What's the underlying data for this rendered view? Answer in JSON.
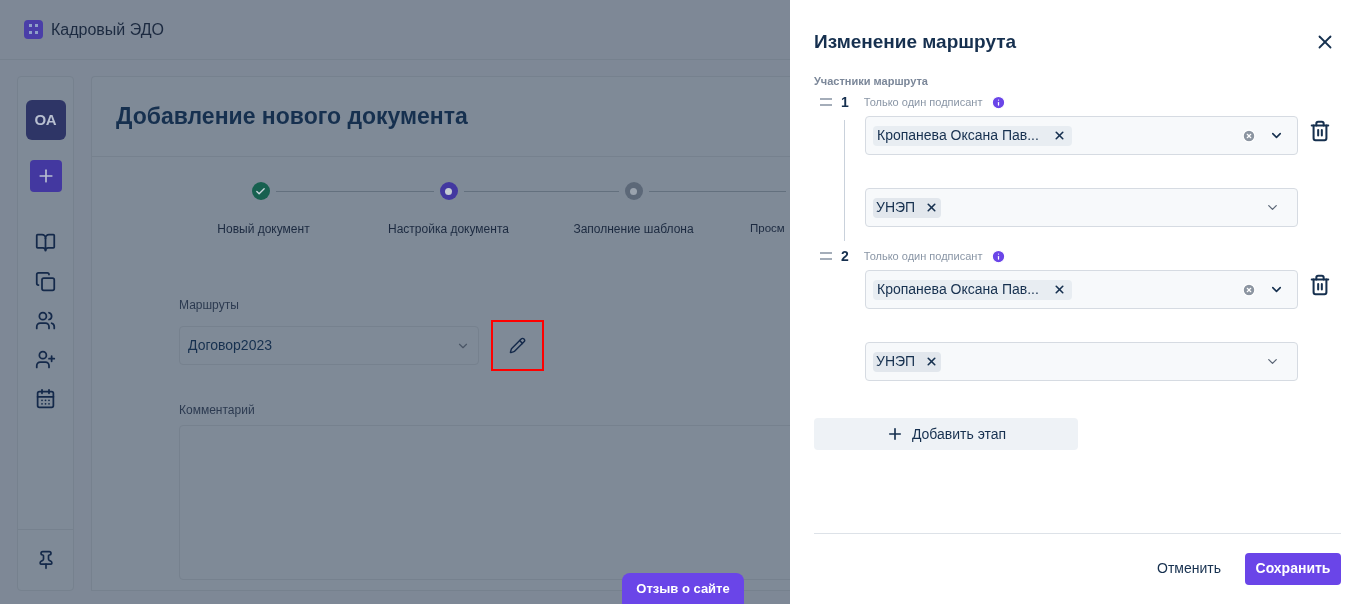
{
  "app": {
    "title": "Кадровый ЭДО"
  },
  "sidebar": {
    "avatar": "ОА"
  },
  "page": {
    "title": "Добавление нового документа",
    "steps": [
      {
        "label": "Новый документ",
        "completed": true,
        "selected": false
      },
      {
        "label": "Настройка документа",
        "completed": false,
        "selected": true
      },
      {
        "label": "Заполнение шаблона",
        "completed": false,
        "selected": false
      },
      {
        "label": "Просм"
      }
    ],
    "routes": {
      "label": "Маршруты",
      "value": "Договор2023"
    },
    "edit_button": {
      "highlighted": true
    },
    "comment": {
      "label": "Комментарий"
    }
  },
  "feedback_button": "Отзыв о сайте",
  "panel": {
    "title": "Изменение маршрута",
    "section_label": "Участники маршрута",
    "stages": [
      {
        "number": "1",
        "mode": "Только один подписант",
        "signer": "Кропанева Оксана Пав...",
        "signature": "УНЭП"
      },
      {
        "number": "2",
        "mode": "Только один подписант",
        "signer": "Кропанева Оксана Пав...",
        "signature": "УНЭП"
      }
    ],
    "add_stage": "Добавить этап",
    "cancel": "Отменить",
    "save": "Сохранить"
  }
}
